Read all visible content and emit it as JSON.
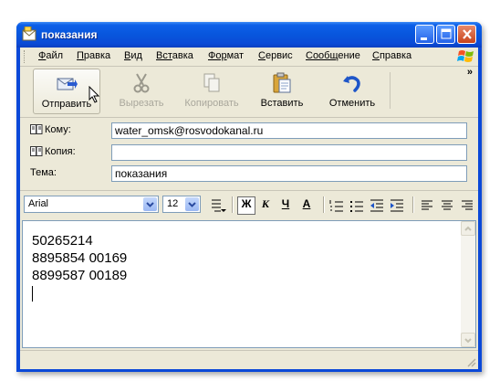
{
  "window": {
    "title": "показания"
  },
  "menu": {
    "items": [
      {
        "label": "Файл",
        "key": "Ф",
        "rest": "айл"
      },
      {
        "label": "Правка",
        "key": "П",
        "rest": "равка"
      },
      {
        "label": "Вид",
        "key": "В",
        "rest": "ид"
      },
      {
        "label": "Вставка",
        "key": "Вст",
        "rest": "авка"
      },
      {
        "label": "Формат",
        "key": "Фор",
        "rest": "мат"
      },
      {
        "label": "Сервис",
        "key": "С",
        "rest": "ервис"
      },
      {
        "label": "Сообщение",
        "key": "Сообщ",
        "rest": "ение"
      },
      {
        "label": "Справка",
        "key": "С",
        "rest": "правка"
      }
    ]
  },
  "toolbar": {
    "send": "Отправить",
    "cut": "Вырезать",
    "copy": "Копировать",
    "paste": "Вставить",
    "undo": "Отменить",
    "more": "»"
  },
  "header": {
    "to_label": "Кому:",
    "to_value": "water_omsk@rosvodokanal.ru",
    "cc_label": "Копия:",
    "cc_value": "",
    "subject_label": "Тема:",
    "subject_value": "показания"
  },
  "format": {
    "font": "Arial",
    "size": "12",
    "bold": "Ж",
    "italic": "К",
    "underline": "Ч",
    "color": "А"
  },
  "message": {
    "lines": [
      "50265214",
      "8895854 00169",
      "8899587 00189"
    ]
  },
  "colors": {
    "title_blue": "#0a4ad6",
    "chrome": "#ece9d8",
    "field_border": "#7f9db9"
  }
}
